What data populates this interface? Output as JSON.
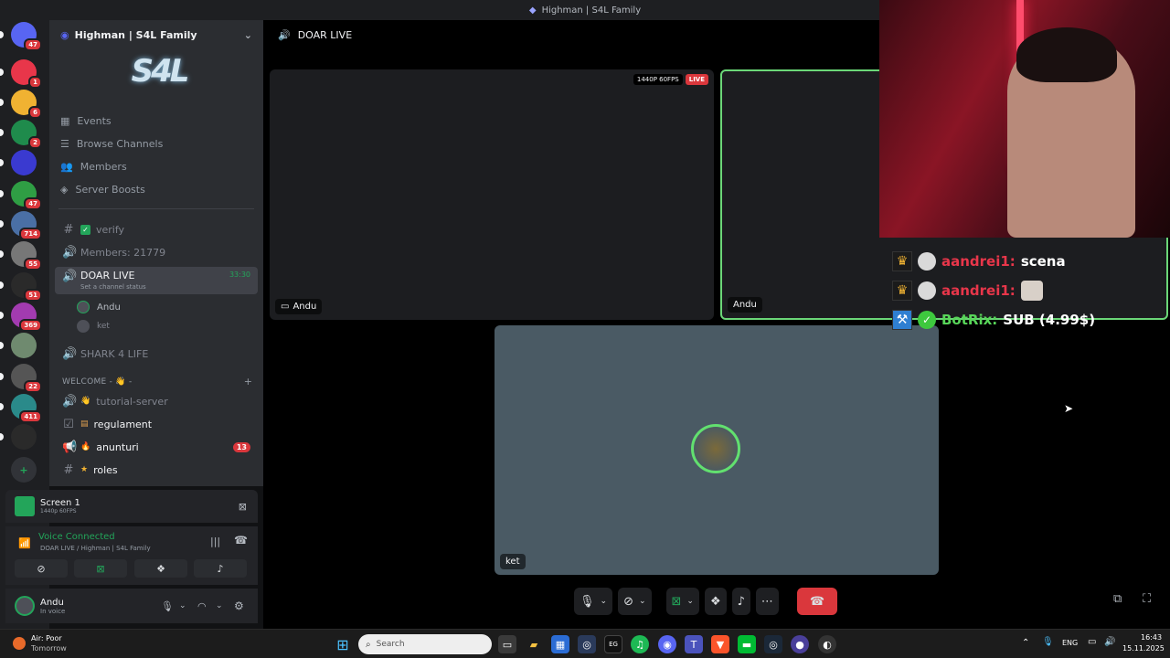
{
  "window": {
    "title": "Highman | S4L Family"
  },
  "guilds": [
    {
      "icon": "discord-logo-icon",
      "badge": "47"
    },
    {
      "icon": "server-r-icon",
      "badge": "1"
    },
    {
      "icon": "server-avatar-icon",
      "badge": "6"
    },
    {
      "icon": "server-green-icon",
      "badge": "2"
    },
    {
      "icon": "server-blue-icon",
      "badge": ""
    },
    {
      "icon": "server-art-icon",
      "badge": "47"
    },
    {
      "icon": "server-s4l-icon",
      "badge": "714"
    },
    {
      "icon": "server-gray-icon",
      "badge": "55"
    },
    {
      "icon": "server-wdg-icon",
      "badge": "51"
    },
    {
      "icon": "server-pink-icon",
      "badge": "369"
    },
    {
      "icon": "server-map-icon",
      "badge": ""
    },
    {
      "icon": "server-robot-icon",
      "badge": "22"
    },
    {
      "icon": "server-grid-icon",
      "badge": "411"
    },
    {
      "icon": "server-se-icon",
      "badge": ""
    }
  ],
  "sidebar": {
    "server_name": "Highman | S4L Family",
    "banner_text": "S4L",
    "links": [
      {
        "label": "Events"
      },
      {
        "label": "Browse Channels"
      },
      {
        "label": "Members"
      },
      {
        "label": "Server Boosts"
      }
    ],
    "channels": [
      {
        "label": "verify"
      },
      {
        "label": "Members: 21779"
      },
      {
        "label": "DOAR LIVE",
        "status": "Set a channel status",
        "timer": "33:30"
      },
      {
        "label": "SHARK 4 LIFE"
      }
    ],
    "voice_users": [
      "Andu",
      "ket"
    ],
    "category": "WELCOME - 👋 -",
    "welcome_channels": [
      {
        "label": "tutorial-server",
        "badge": ""
      },
      {
        "label": "regulament",
        "badge": ""
      },
      {
        "label": "anunturi",
        "badge": "13"
      },
      {
        "label": "roles",
        "badge": ""
      }
    ]
  },
  "panels": {
    "screen": {
      "title": "Screen 1",
      "quality": "1440p 60FPS"
    },
    "voice": {
      "status": "Voice Connected",
      "channel": "DOAR LIVE / Highman | S4L Family"
    },
    "user": {
      "name": "Andu",
      "status": "In voice"
    }
  },
  "main": {
    "channel": "DOAR LIVE",
    "quality_badge": "1440P 60FPS",
    "live_badge": "LIVE",
    "tiles": [
      {
        "label": "Andu"
      },
      {
        "label": "Andu"
      },
      {
        "label": "ket"
      }
    ]
  },
  "overlay": {
    "chat": [
      {
        "user": "aandrei1:",
        "message": "scena",
        "user_color": "#e8364a"
      },
      {
        "user": "aandrei1:",
        "message": "",
        "user_color": "#e8364a"
      },
      {
        "user": "BotRix:",
        "message": "SUB (4.99$)",
        "user_color": "#58d659"
      }
    ]
  },
  "taskbar": {
    "weather_title": "Air: Poor",
    "weather_sub": "Tomorrow",
    "search_placeholder": "Search",
    "lang": "ENG",
    "time": "16:43",
    "date": "15.11.2025"
  }
}
